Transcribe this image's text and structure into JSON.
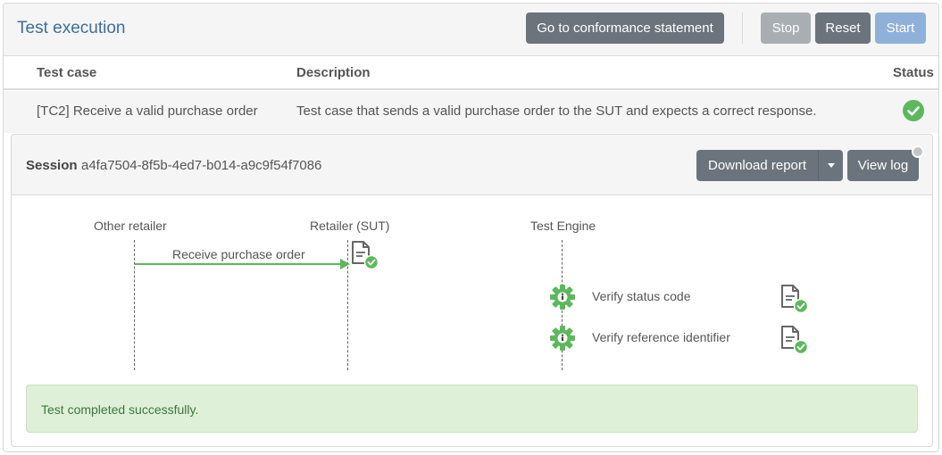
{
  "header": {
    "title": "Test execution",
    "conformance_button": "Go to conformance statement",
    "stop_button": "Stop",
    "reset_button": "Reset",
    "start_button": "Start"
  },
  "table": {
    "columns": [
      "Test case",
      "Description",
      "Status"
    ],
    "rows": [
      {
        "test_case": "[TC2] Receive a valid purchase order",
        "description": "Test case that sends a valid purchase order to the SUT and expects a correct response.",
        "status": "success"
      }
    ]
  },
  "session": {
    "label": "Session",
    "id": "a4fa7504-8f5b-4ed7-b014-a9c9f54f7086",
    "download_button": "Download report",
    "view_log_button": "View log"
  },
  "diagram": {
    "actors": [
      "Other retailer",
      "Retailer (SUT)",
      "Test Engine"
    ],
    "message": "Receive purchase order",
    "steps": [
      "Verify status code",
      "Verify reference identifier"
    ]
  },
  "result": {
    "message": "Test completed successfully."
  },
  "colors": {
    "title": "#3d6e9c",
    "success": "#5cb85c",
    "button_dark": "#6b747c",
    "button_disabled": "#a9aeb2",
    "button_primary_disabled": "#8fb1d9",
    "success_bg": "#dff0d8"
  }
}
